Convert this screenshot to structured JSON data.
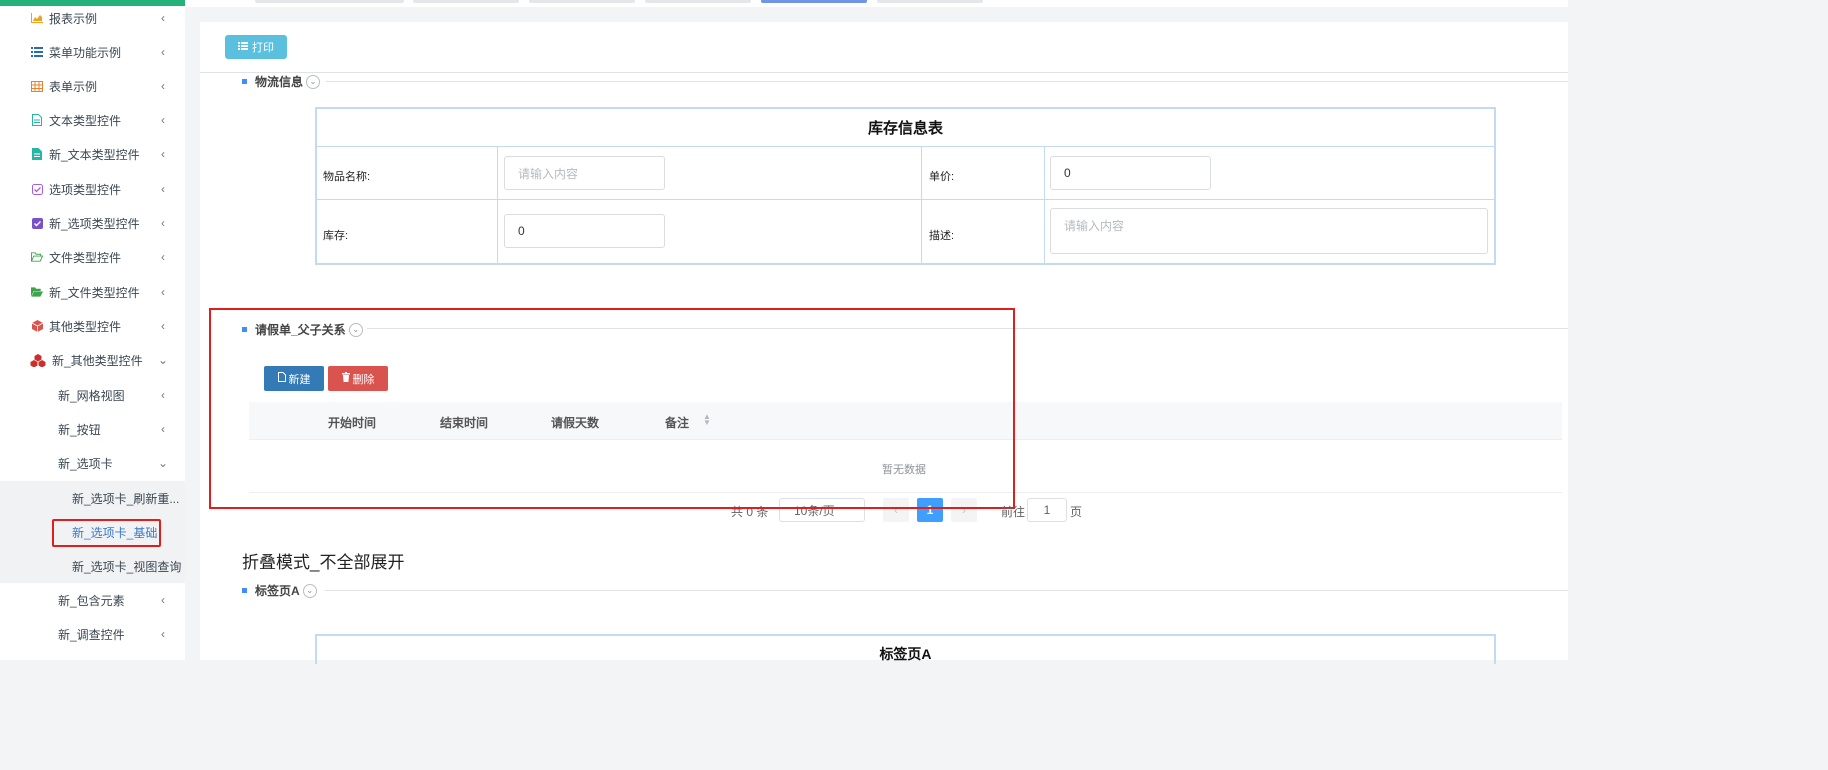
{
  "sidebar": {
    "items": [
      {
        "label": "报表示例",
        "icon": "chart-icon",
        "chevron": "‹"
      },
      {
        "label": "菜单功能示例",
        "icon": "list-icon",
        "chevron": "‹"
      },
      {
        "label": "表单示例",
        "icon": "table-icon",
        "chevron": "‹"
      },
      {
        "label": "文本类型控件",
        "icon": "file-text-icon",
        "chevron": "‹"
      },
      {
        "label": "新_文本类型控件",
        "icon": "file-icon",
        "chevron": "‹"
      },
      {
        "label": "选项类型控件",
        "icon": "checkbox-outline-icon",
        "chevron": "‹"
      },
      {
        "label": "新_选项类型控件",
        "icon": "checkbox-filled-icon",
        "chevron": "‹"
      },
      {
        "label": "文件类型控件",
        "icon": "folder-open-outline-icon",
        "chevron": "‹"
      },
      {
        "label": "新_文件类型控件",
        "icon": "folder-open-icon",
        "chevron": "‹"
      },
      {
        "label": "其他类型控件",
        "icon": "cube-icon",
        "chevron": "‹"
      },
      {
        "label": "新_其他类型控件",
        "icon": "cubes-icon",
        "chevron": "⌄"
      }
    ],
    "sub_items": [
      {
        "label": "新_网格视图",
        "chevron": "‹"
      },
      {
        "label": "新_按钮",
        "chevron": "‹"
      },
      {
        "label": "新_选项卡",
        "chevron": "⌄"
      }
    ],
    "subsub_items": [
      {
        "label": "新_选项卡_刷新重..."
      },
      {
        "label": "新_选项卡_基础"
      },
      {
        "label": "新_选项卡_视图查询"
      }
    ],
    "tail_items": [
      {
        "label": "新_包含元素",
        "chevron": "‹"
      },
      {
        "label": "新_调查控件",
        "chevron": "‹"
      }
    ]
  },
  "toolbar": {
    "print_label": "打印"
  },
  "logistics": {
    "section_title": "物流信息",
    "table_title": "库存信息表",
    "item_name_label": "物品名称:",
    "item_name_placeholder": "请输入内容",
    "price_label": "单价:",
    "price_value": "0",
    "stock_label": "库存:",
    "stock_value": "0",
    "desc_label": "描述:",
    "desc_placeholder": "请输入内容"
  },
  "leave": {
    "section_title": "请假单_父子关系",
    "new_label": "新建",
    "delete_label": "删除",
    "columns": [
      "开始时间",
      "结束时间",
      "请假天数",
      "备注"
    ],
    "empty_text": "暂无数据"
  },
  "pager": {
    "total": "共 0 条",
    "page_size": "10条/页",
    "prev": "‹",
    "current": "1",
    "next": "›",
    "goto_label": "前往",
    "goto_value": "1",
    "page_label": "页"
  },
  "fold": {
    "title": "折叠模式_不全部展开",
    "tab_a_section": "标签页A",
    "tab_a_caption": "标签页A"
  },
  "colors": {
    "accent_green": "#25b27a",
    "print_button": "#5bc0de",
    "new_button": "#337ab7",
    "delete_button": "#d9534f",
    "highlight_red": "#e01e1e",
    "pager_active": "#409eff"
  }
}
